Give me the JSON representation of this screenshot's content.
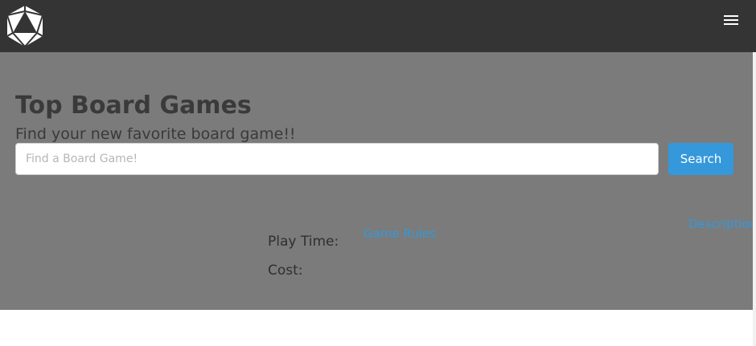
{
  "navbar": {
    "logo_icon": "d20-dice-icon",
    "menu_icon": "hamburger-menu-icon",
    "background": "#343434"
  },
  "hero": {
    "title": "Top Board Games",
    "subtitle": "Find your new favorite board game!!"
  },
  "search": {
    "placeholder": "Find a Board Game!",
    "value": "",
    "button_label": "Search",
    "button_color": "#3498db"
  },
  "game_details": {
    "play_time_label": "Play Time:",
    "cost_label": "Cost:",
    "game_rules_link": "Game Rules",
    "description_link": "Description"
  },
  "colors": {
    "overlay": "#7b7b7b",
    "link": "#3498db"
  }
}
